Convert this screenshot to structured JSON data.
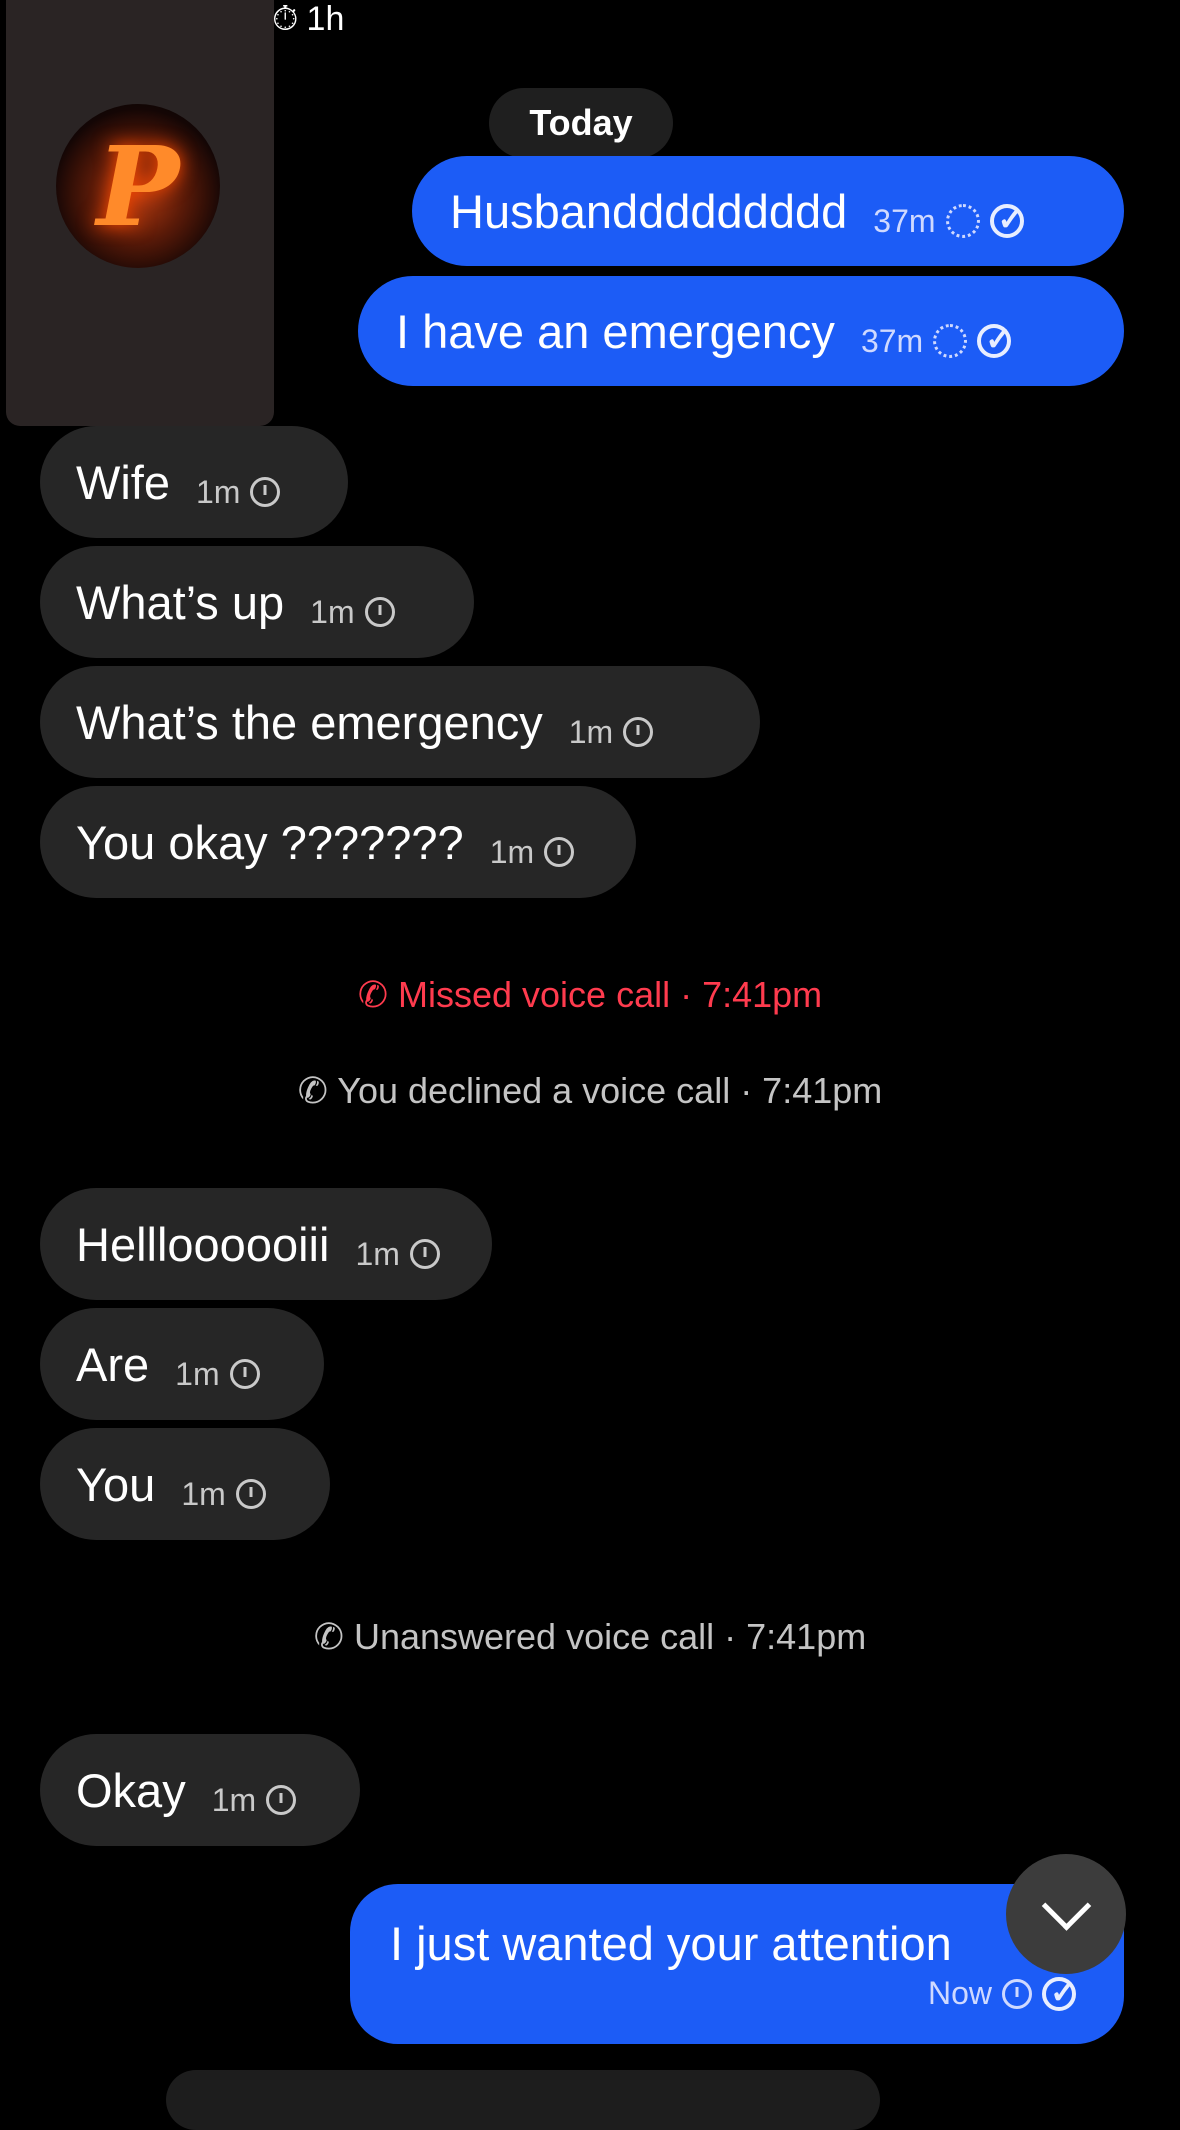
{
  "header": {
    "timer_label": "1h",
    "timer_icon": "timer-icon"
  },
  "conversation": {
    "date_separator": "Today",
    "messages_top_sent": [
      {
        "text": "Husbanddddddddd",
        "time": "37m",
        "status_icons": [
          "pending-icon",
          "seen-icon"
        ]
      },
      {
        "text": "I have an emergency",
        "time": "37m",
        "status_icons": [
          "pending-icon",
          "seen-icon"
        ]
      }
    ],
    "received_group_1": [
      {
        "text": "Wife",
        "time": "1m"
      },
      {
        "text": "What’s up",
        "time": "1m"
      },
      {
        "text": "What’s the emergency",
        "time": "1m"
      },
      {
        "text": "You okay ???????",
        "time": "1m"
      }
    ],
    "calls_1": [
      {
        "text": "Missed voice call · 7:41pm",
        "type": "missed",
        "color": "#ff3b4e"
      },
      {
        "text": "You declined a voice call · 7:41pm",
        "type": "declined"
      }
    ],
    "received_group_2": [
      {
        "text": "Hellloooooiii",
        "time": "1m"
      },
      {
        "text": "Are",
        "time": "1m"
      },
      {
        "text": "You",
        "time": "1m"
      }
    ],
    "calls_2": [
      {
        "text": "Unanswered voice call · 7:41pm",
        "type": "unanswered"
      }
    ],
    "received_group_3": [
      {
        "text": "Okay",
        "time": "1m"
      }
    ],
    "last_sent": {
      "text": "I just wanted your attention",
      "time": "Now"
    }
  },
  "colors": {
    "sent_bubble": "#1c5cf6",
    "received_bubble": "#262626",
    "background": "#000000"
  }
}
